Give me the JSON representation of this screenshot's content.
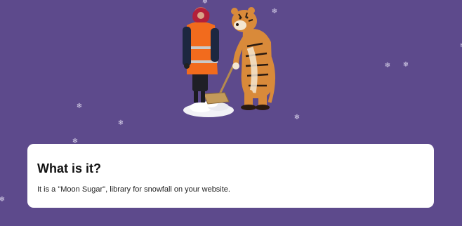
{
  "colors": {
    "background": "#5d4a8c",
    "card": "#ffffff",
    "snowflake": "#d8d2ea",
    "vest": "#f26b1d",
    "tiger": "#d98a3a"
  },
  "snowflakes": {
    "glyph": "❄",
    "icon": "snowflake-icon"
  },
  "illustration": {
    "icon": "worker-and-tiger-shoveling-snow"
  },
  "card": {
    "title": "What is it?",
    "description": "It is a \"Moon Sugar\", library for snowfall on your website."
  }
}
